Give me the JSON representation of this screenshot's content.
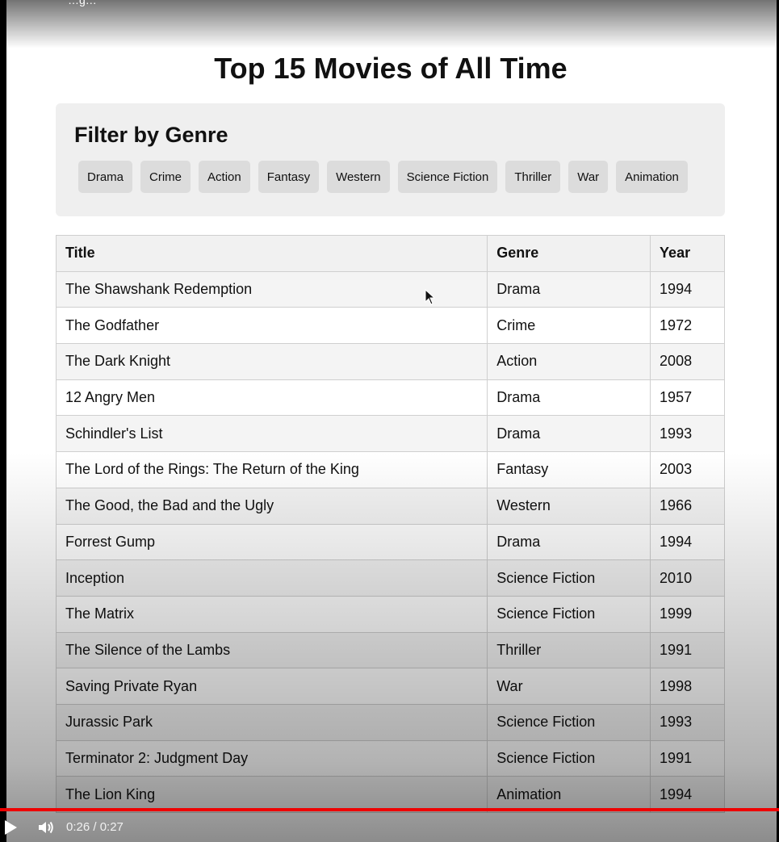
{
  "page": {
    "cut_text": "…g…",
    "title": "Top 15 Movies of All Time"
  },
  "filter": {
    "heading": "Filter by Genre",
    "genres": [
      "Drama",
      "Crime",
      "Action",
      "Fantasy",
      "Western",
      "Science Fiction",
      "Thriller",
      "War",
      "Animation"
    ]
  },
  "table": {
    "headers": [
      "Title",
      "Genre",
      "Year"
    ],
    "rows": [
      [
        "The Shawshank Redemption",
        "Drama",
        "1994"
      ],
      [
        "The Godfather",
        "Crime",
        "1972"
      ],
      [
        "The Dark Knight",
        "Action",
        "2008"
      ],
      [
        "12 Angry Men",
        "Drama",
        "1957"
      ],
      [
        "Schindler's List",
        "Drama",
        "1993"
      ],
      [
        "The Lord of the Rings: The Return of the King",
        "Fantasy",
        "2003"
      ],
      [
        "The Good, the Bad and the Ugly",
        "Western",
        "1966"
      ],
      [
        "Forrest Gump",
        "Drama",
        "1994"
      ],
      [
        "Inception",
        "Science Fiction",
        "2010"
      ],
      [
        "The Matrix",
        "Science Fiction",
        "1999"
      ],
      [
        "The Silence of the Lambs",
        "Thriller",
        "1991"
      ],
      [
        "Saving Private Ryan",
        "War",
        "1998"
      ],
      [
        "Jurassic Park",
        "Science Fiction",
        "1993"
      ],
      [
        "Terminator 2: Judgment Day",
        "Science Fiction",
        "1991"
      ],
      [
        "The Lion King",
        "Animation",
        "1994"
      ]
    ]
  },
  "video": {
    "time": "0:26 / 0:27",
    "progress_fraction": 1.0,
    "play_icon": "play-icon",
    "volume_icon": "volume-icon",
    "progress_color": "#ee0000"
  }
}
